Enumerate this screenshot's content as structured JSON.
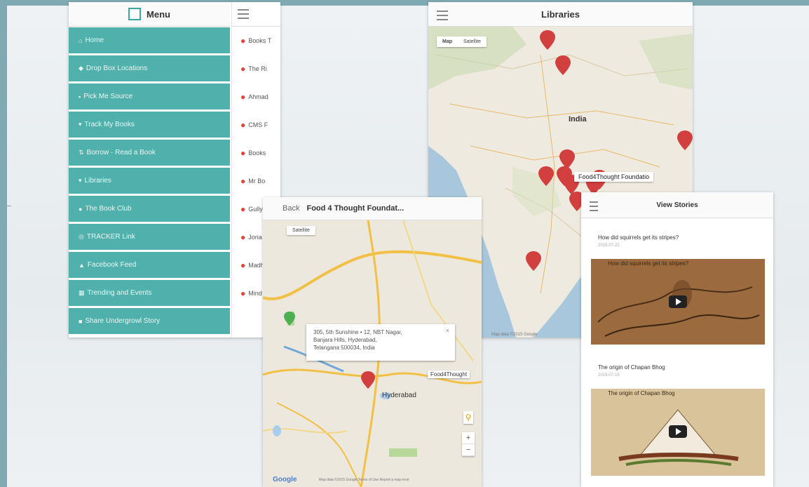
{
  "colors": {
    "teal": "#4fb0ac",
    "background": "#7fa9b3",
    "pin": "#d23f3f"
  },
  "menu": {
    "title": "Menu",
    "items": [
      {
        "icon": "home-icon",
        "glyph": "⌂",
        "label": "Home"
      },
      {
        "icon": "map-marker-icon",
        "glyph": "◆",
        "label": "Drop Box Locations"
      },
      {
        "icon": "book-icon",
        "glyph": "▪",
        "label": "Pick Me Source"
      },
      {
        "icon": "tracking-icon",
        "glyph": "▾",
        "label": "Track My Books"
      },
      {
        "icon": "borrow-icon",
        "glyph": "⇅",
        "label": "Borrow · Read a Book"
      },
      {
        "icon": "library-icon",
        "glyph": "▾",
        "label": "Libraries"
      },
      {
        "icon": "club-icon",
        "glyph": "●",
        "label": "The Book Club"
      },
      {
        "icon": "tracker-icon",
        "glyph": "◎",
        "label": "TRACKER Link"
      },
      {
        "icon": "facebook-icon",
        "glyph": "▲",
        "label": "Facebook Feed"
      },
      {
        "icon": "calendar-icon",
        "glyph": "▦",
        "label": "Trending and Events"
      },
      {
        "icon": "share-icon",
        "glyph": "■",
        "label": "Share Undergrowl Story"
      }
    ]
  },
  "library_list": {
    "items": [
      "Books T",
      "The Ri",
      "Ahmad",
      "CMS F",
      "Books",
      "Mr Bo",
      "Gully",
      "Joria",
      "Madhu",
      "Mind"
    ]
  },
  "libraries": {
    "title": "Libraries",
    "map_type": [
      "Map",
      "Satellite"
    ],
    "country_label": "India",
    "tooltip": "Food4Thought Foundatio",
    "footer": "Map data ©2015 Google"
  },
  "food4thought": {
    "back": "Back",
    "title": "Food 4 Thought Foundat...",
    "map_type": "Satellite",
    "info_lines": [
      "305, 5th Sunshine • 12, NBT Nagar,",
      "Banjara Hills, Hyderabad,",
      "Telangana 500034, India"
    ],
    "info_close": "×",
    "tooltip": "Food4Thought",
    "city_label": "Hyderabad",
    "google": "Google",
    "footer": "Map data ©2015 Google   Terms of Use   Report a map error",
    "zoom_in": "+",
    "zoom_out": "−"
  },
  "stories": {
    "title": "View Stories",
    "items": [
      {
        "title": "How did squirrels get its stripes?",
        "date": "2015-07-22",
        "caption": "How did squirrels get its stripes?"
      },
      {
        "title": "The origin of Chapan Bhog",
        "date": "2015-07-15",
        "caption": "The origin of Chapan Bhog"
      }
    ]
  }
}
